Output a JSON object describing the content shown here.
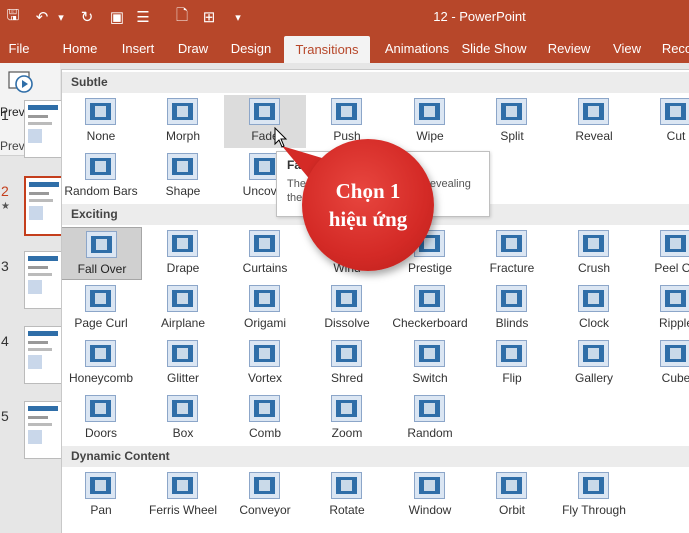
{
  "titlebar": {
    "doc_title": "12  -  PowerPoint",
    "qat": [
      {
        "icon": "save-icon",
        "glyph": "🖫"
      },
      {
        "icon": "undo-icon",
        "glyph": "↶"
      },
      {
        "icon": "undo-dropdown-icon",
        "glyph": "▾"
      },
      {
        "icon": "redo-icon",
        "glyph": "↻"
      },
      {
        "icon": "slideshow-icon",
        "glyph": "▣"
      },
      {
        "icon": "align-icon",
        "glyph": "☰"
      },
      {
        "icon": "new-file-icon",
        "glyph": "🗋"
      },
      {
        "icon": "new-slide-icon",
        "glyph": "⊞"
      },
      {
        "icon": "customize-qat-icon",
        "glyph": "▾"
      }
    ]
  },
  "tabs": [
    "File",
    "Home",
    "Insert",
    "Draw",
    "Design",
    "Transitions",
    "Animations",
    "Slide Show",
    "Review",
    "View",
    "Reco"
  ],
  "active_tab": "Transitions",
  "preview": {
    "button": "Preview",
    "group": "Preview"
  },
  "slides": [
    {
      "num": "1"
    },
    {
      "num": "2",
      "selected": true,
      "star": "★"
    },
    {
      "num": "3"
    },
    {
      "num": "4"
    },
    {
      "num": "5"
    }
  ],
  "gallery": {
    "sections": [
      {
        "title": "Subtle",
        "items": [
          "None",
          "Morph",
          "Fade",
          "Push",
          "Wipe",
          "Split",
          "Reveal",
          "Cut",
          "Random Bars",
          "Shape",
          "Uncover"
        ]
      },
      {
        "title": "Exciting",
        "items": [
          "Fall Over",
          "Drape",
          "Curtains",
          "Wind",
          "Prestige",
          "Fracture",
          "Crush",
          "Peel Off",
          "Page Curl",
          "Airplane",
          "Origami",
          "Dissolve",
          "Checkerboard",
          "Blinds",
          "Clock",
          "Ripple",
          "Honeycomb",
          "Glitter",
          "Vortex",
          "Shred",
          "Switch",
          "Flip",
          "Gallery",
          "Cube",
          "Doors",
          "Box",
          "Comb",
          "Zoom",
          "Random"
        ]
      },
      {
        "title": "Dynamic Content",
        "items": [
          "Pan",
          "Ferris Wheel",
          "Conveyor",
          "Rotate",
          "Window",
          "Orbit",
          "Fly Through"
        ]
      }
    ],
    "selected": "Fall Over",
    "hovered": "Fade"
  },
  "tooltip": {
    "title": "Fade",
    "desc": "The slide fades in gradually, revealing the slide."
  },
  "callout": {
    "line1": "Chọn 1",
    "line2": "hiệu ứng"
  },
  "colors": {
    "ribbon": "#b7472a",
    "callout": "#d42a26",
    "icon": "#2f6ea8"
  }
}
